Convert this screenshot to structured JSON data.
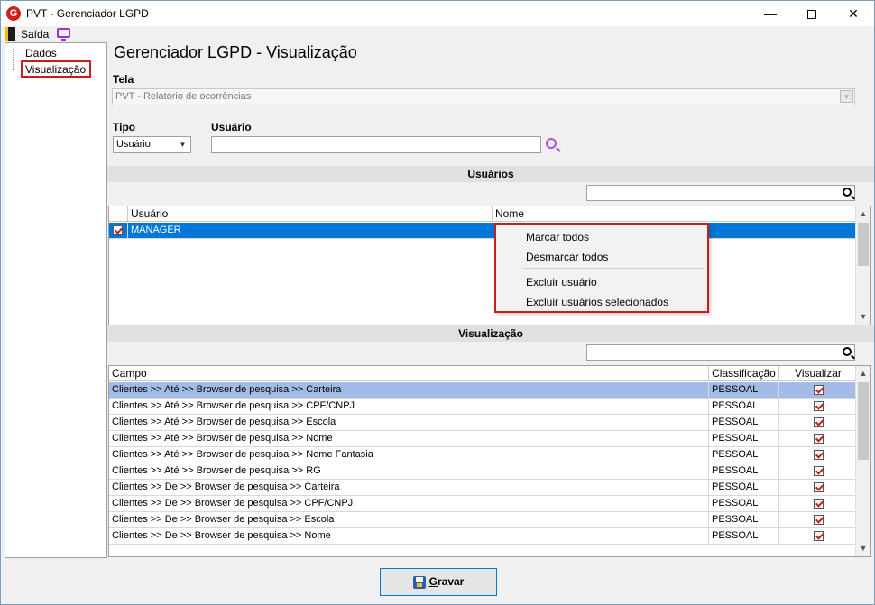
{
  "window": {
    "title": "PVT - Gerenciador LGPD",
    "min_glyph": "—",
    "close_glyph": "✕"
  },
  "menu": {
    "exit_label": "Saída",
    "icons": [
      "exit-door-icon",
      "monitor-icon"
    ]
  },
  "tree": {
    "items": [
      {
        "label": "Dados"
      },
      {
        "label": "Visualização"
      }
    ]
  },
  "page": {
    "title": "Gerenciador LGPD - Visualização"
  },
  "tela": {
    "label": "Tela",
    "value": "PVT - Relatório de ocorrências"
  },
  "tipo": {
    "label": "Tipo",
    "value": "Usuário"
  },
  "usuario_field": {
    "label": "Usuário",
    "value": ""
  },
  "usuarios_section": {
    "title": "Usuários",
    "columns": [
      "Usuário",
      "Nome"
    ],
    "rows": [
      {
        "checked": true,
        "usuario": "MANAGER",
        "nome": ""
      }
    ]
  },
  "context_menu": {
    "items": [
      "Marcar todos",
      "Desmarcar todos",
      "Excluir usuário",
      "Excluir usuários selecionados"
    ]
  },
  "visualizacao_section": {
    "title": "Visualização",
    "columns": [
      "Campo",
      "Classificação",
      "Visualizar"
    ],
    "rows": [
      {
        "campo": "Clientes >> Até >> Browser de pesquisa >> Carteira",
        "classificacao": "PESSOAL",
        "visualizar": true
      },
      {
        "campo": "Clientes >> Até >> Browser de pesquisa >> CPF/CNPJ",
        "classificacao": "PESSOAL",
        "visualizar": true
      },
      {
        "campo": "Clientes >> Até >> Browser de pesquisa >> Escola",
        "classificacao": "PESSOAL",
        "visualizar": true
      },
      {
        "campo": "Clientes >> Até >> Browser de pesquisa >> Nome",
        "classificacao": "PESSOAL",
        "visualizar": true
      },
      {
        "campo": "Clientes >> Até >> Browser de pesquisa >> Nome Fantasia",
        "classificacao": "PESSOAL",
        "visualizar": true
      },
      {
        "campo": "Clientes >> Até >> Browser de pesquisa >> RG",
        "classificacao": "PESSOAL",
        "visualizar": true
      },
      {
        "campo": "Clientes >> De >> Browser de pesquisa >> Carteira",
        "classificacao": "PESSOAL",
        "visualizar": true
      },
      {
        "campo": "Clientes >> De >> Browser de pesquisa >> CPF/CNPJ",
        "classificacao": "PESSOAL",
        "visualizar": true
      },
      {
        "campo": "Clientes >> De >> Browser de pesquisa >> Escola",
        "classificacao": "PESSOAL",
        "visualizar": true
      },
      {
        "campo": "Clientes >> De >> Browser de pesquisa >> Nome",
        "classificacao": "PESSOAL",
        "visualizar": true
      }
    ]
  },
  "footer": {
    "save_first_letter": "G",
    "save_rest": "ravar"
  },
  "colors": {
    "selection_blue": "#0078d7",
    "row_highlight": "#a3bce7",
    "annotation_red": "#d01a1a",
    "logo_red": "#d11d1d",
    "search_purple": "#b050d0"
  }
}
